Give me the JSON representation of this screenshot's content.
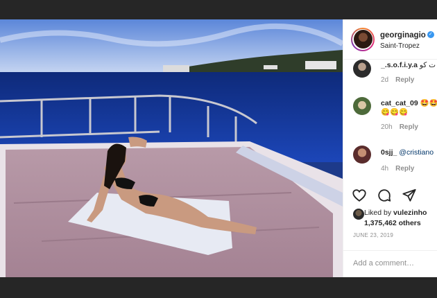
{
  "post": {
    "username": "georginagio",
    "location": "Saint-Tropez",
    "verified_icon": "verified-badge-icon",
    "date": "JUNE 23, 2019",
    "comment_placeholder": "Add a comment…"
  },
  "comments": [
    {
      "user": "_.s.o.f.i.y.a",
      "text": "ت کو",
      "time": "2d",
      "reply": "Reply"
    },
    {
      "user": "cat_cat_09",
      "text": "🤩🤩",
      "text2": "😋😋😋",
      "time": "20h",
      "reply": "Reply"
    },
    {
      "user": "0sjj_",
      "text": "@cristiano",
      "time": "4h",
      "reply": "Reply"
    }
  ],
  "likes": {
    "liked_by_prefix": "Liked by",
    "liked_by_user": "vulezinho",
    "others": "1,375,462 others"
  },
  "icons": {
    "like": "heart-icon",
    "comment": "comment-bubble-icon",
    "share": "paper-plane-icon"
  },
  "colors": {
    "link": "#003569",
    "verified": "#3897f0",
    "muted": "#8e8e8e"
  }
}
